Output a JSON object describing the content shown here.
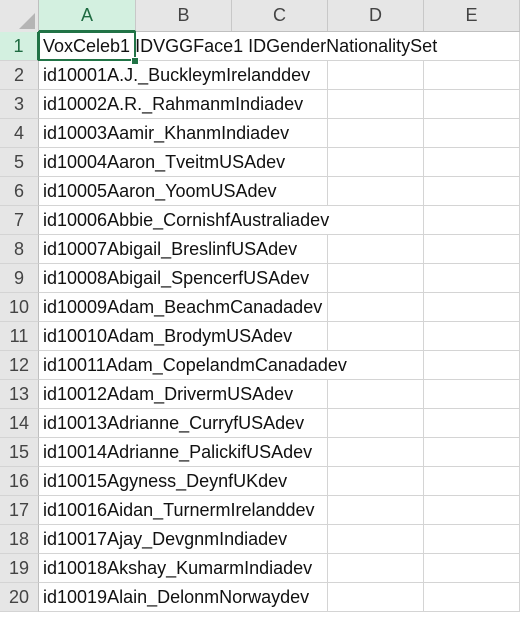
{
  "columns": [
    "A",
    "B",
    "C",
    "D",
    "E"
  ],
  "rows": [
    {
      "num": "1",
      "a": "VoxCeleb1 IDVGGFace1 IDGenderNationalitySet"
    },
    {
      "num": "2",
      "a": "id10001A.J._BuckleymIrelanddev"
    },
    {
      "num": "3",
      "a": "id10002A.R._RahmanmIndiadev"
    },
    {
      "num": "4",
      "a": "id10003Aamir_KhanmIndiadev"
    },
    {
      "num": "5",
      "a": "id10004Aaron_TveitmUSAdev"
    },
    {
      "num": "6",
      "a": "id10005Aaron_YoomUSAdev"
    },
    {
      "num": "7",
      "a": "id10006Abbie_CornishfAustraliadev"
    },
    {
      "num": "8",
      "a": "id10007Abigail_BreslinfUSAdev"
    },
    {
      "num": "9",
      "a": "id10008Abigail_SpencerfUSAdev"
    },
    {
      "num": "10",
      "a": "id10009Adam_BeachmCanadadev"
    },
    {
      "num": "11",
      "a": "id10010Adam_BrodymUSAdev"
    },
    {
      "num": "12",
      "a": "id10011Adam_CopelandmCanadadev"
    },
    {
      "num": "13",
      "a": "id10012Adam_DrivermUSAdev"
    },
    {
      "num": "14",
      "a": "id10013Adrianne_CurryfUSAdev"
    },
    {
      "num": "15",
      "a": "id10014Adrianne_PalickifUSAdev"
    },
    {
      "num": "16",
      "a": "id10015Agyness_DeynfUKdev"
    },
    {
      "num": "17",
      "a": "id10016Aidan_TurnermIrelanddev"
    },
    {
      "num": "18",
      "a": "id10017Ajay_DevgnmIndiadev"
    },
    {
      "num": "19",
      "a": "id10018Akshay_KumarmIndiadev"
    },
    {
      "num": "20",
      "a": "id10019Alain_DelonmNorwaydev"
    }
  ],
  "selection": {
    "column": "A",
    "row": "1"
  },
  "colors": {
    "accent": "#217346",
    "header_bg": "#e6e6e6",
    "header_selected_bg": "#d3f0e0",
    "gridline": "#d4d4d4"
  }
}
